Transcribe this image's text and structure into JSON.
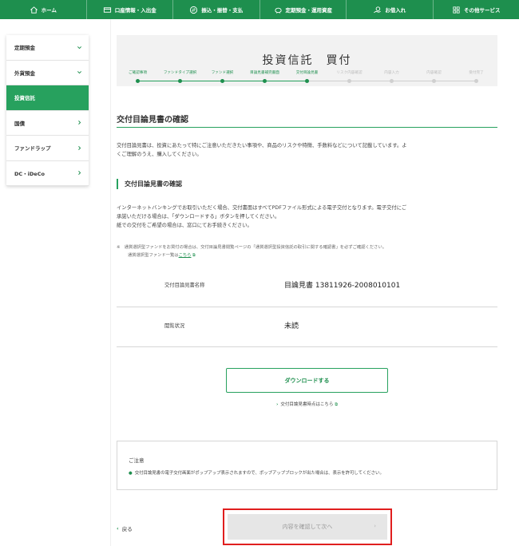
{
  "topnav": {
    "items": [
      {
        "label": "ホーム",
        "icon": "home-icon"
      },
      {
        "label": "口座情報・入出金",
        "icon": "card-icon"
      },
      {
        "label": "振込・振替・支払",
        "icon": "transfer-icon"
      },
      {
        "label": "定期預金・運用資産",
        "icon": "piggy-bank-icon"
      },
      {
        "label": "お借入れ",
        "icon": "loan-icon"
      },
      {
        "label": "その他サービス",
        "icon": "grid-icon"
      }
    ]
  },
  "sidebar": {
    "items": [
      {
        "label": "定期預金",
        "chevron": "down"
      },
      {
        "label": "外貨預金",
        "chevron": "down"
      },
      {
        "label": "投資信託",
        "chevron": "none",
        "active": true
      },
      {
        "label": "国債",
        "chevron": "right"
      },
      {
        "label": "ファンドラップ",
        "chevron": "right"
      },
      {
        "label": "DC・iDeCo",
        "chevron": "right"
      }
    ]
  },
  "header": {
    "title": "投資信託　買付"
  },
  "steps": [
    {
      "label": "ご確認事項",
      "done": true
    },
    {
      "label": "ファンドタイプ選択",
      "done": true
    },
    {
      "label": "ファンド選択",
      "done": true
    },
    {
      "label": "目論見書補完書面",
      "done": true
    },
    {
      "label": "交付目論見書",
      "done": true
    },
    {
      "label": "リスク内容確認",
      "done": false
    },
    {
      "label": "内容入力",
      "done": false
    },
    {
      "label": "内容確認",
      "done": false
    },
    {
      "label": "受付完了",
      "done": false
    }
  ],
  "section": {
    "title": "交付目論見書の確認",
    "intro_line1": "交付目論見書は、投資にあたって特にご注意いただきたい事項や、商品のリスクや特徴、手数料などについて記載しています。よ",
    "intro_line2": "くご理解のうえ、購入してください。"
  },
  "subsection": {
    "title": "交付目論見書の確認",
    "desc_line1": "インターネットバンキングでお取引いただく場合、交付書面はすべてPDFファイル形式による電子交付となります。電子交付にご",
    "desc_line2": "承諾いただける場合は、「ダウンロードする」ボタンを押してください。",
    "desc_line3": "紙での交付をご希望の場合は、窓口にてお手続きください。",
    "note_line1": "※　通貨選択型ファンドをお買付の場合は、交付目論見書閲覧ページの「通貨選択型投資信託の取引に関する確認書」を必ずご確認ください。",
    "note_line2_prefix": "通貨選択型ファンド一覧は",
    "note_link": "こちら"
  },
  "info": {
    "doc_name_label": "交付目論見書名称",
    "doc_name_value": "目論見書 13811926-2008010101",
    "status_label": "閲覧状況",
    "status_value": "未読"
  },
  "download": {
    "button_label": "ダウンロードする",
    "link_label": "交付目論見書時点はこちら"
  },
  "caution": {
    "title": "ご注意",
    "body": "交付目論見書の電子交付画面がポップアップ表示されますので、ポップアップブロックが出た場合は、表示を許可してください。"
  },
  "footer": {
    "back_label": "戻る",
    "next_label": "内容を確認して次へ"
  },
  "colors": {
    "brand_green": "#1e8f4e",
    "active_green": "#27a15e",
    "highlight_red": "#e01e1e"
  }
}
